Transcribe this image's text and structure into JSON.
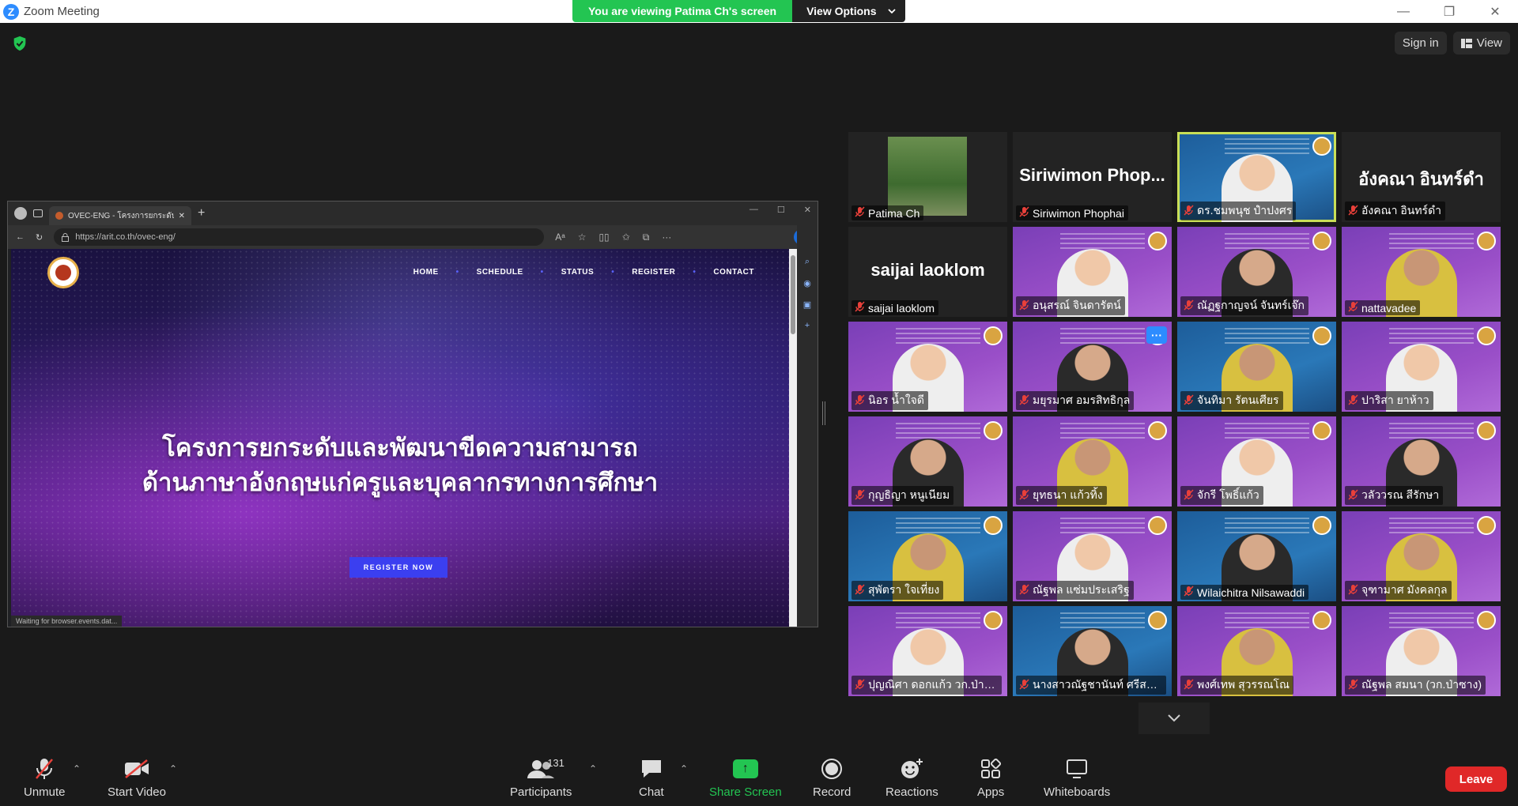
{
  "window": {
    "app_title": "Zoom Meeting",
    "logo_letter": "Z",
    "minimize": "—",
    "restore": "❐",
    "close": "✕"
  },
  "banner": {
    "message": "You are viewing Patima Ch's screen",
    "view_options": "View Options"
  },
  "top_right": {
    "sign_in": "Sign in",
    "view": "View"
  },
  "shared_screen": {
    "tab_title": "OVEC-ENG - โครงการยกระดับและ",
    "new_tab": "+",
    "url": "https://arit.co.th/ovec-eng/",
    "site": {
      "nav": [
        "HOME",
        "SCHEDULE",
        "STATUS",
        "REGISTER",
        "CONTACT"
      ],
      "hero_line1": "โครงการยกระดับและพัฒนาขีดความสามารถ",
      "hero_line2": "ด้านภาษาอังกฤษแก่ครูและบุคลากรทางการศึกษา",
      "register_button": "REGISTER NOW",
      "status_text": "Waiting for browser.events.dat..."
    }
  },
  "participants": [
    {
      "name": "Patima Ch",
      "type": "photo"
    },
    {
      "name": "Siriwimon Phophai",
      "type": "name",
      "big": "Siriwimon  Phop..."
    },
    {
      "name": "ดร.ชมพนุช ปำปงศร",
      "type": "slide-blue",
      "active": true
    },
    {
      "name": "อังคณา  อินทร์ดำ",
      "type": "name",
      "big": "อังคณา  อินทร์ดำ"
    },
    {
      "name": "saijai laoklom",
      "type": "name",
      "big": "saijai laoklom"
    },
    {
      "name": "อนุสรณ์ จินดารัตน์",
      "type": "slide"
    },
    {
      "name": "ณัฏฐกาญจน์  จันทร์เจ๊ก",
      "type": "slide"
    },
    {
      "name": "nattavadee",
      "type": "slide"
    },
    {
      "name": "นิอร  น้ำใจดี",
      "type": "slide"
    },
    {
      "name": "มยุรมาศ อมรสิทธิกุล",
      "type": "slide",
      "more": "···"
    },
    {
      "name": "จันทิมา รัตนเศียร",
      "type": "slide-blue"
    },
    {
      "name": "ปาริสา ยาห้าว",
      "type": "slide"
    },
    {
      "name": "กุญธิญา หนูเนียม",
      "type": "slide"
    },
    {
      "name": "ยุทธนา แก้วทิ้ง",
      "type": "slide"
    },
    {
      "name": "จักรี โพธิ์แก้ว",
      "type": "slide"
    },
    {
      "name": "วลัววรณ สีรักษา",
      "type": "slide"
    },
    {
      "name": "สุพัตรา ใจเที่ยง",
      "type": "slide-blue"
    },
    {
      "name": "ณัฐพล แซ่มประเสริฐ",
      "type": "slide"
    },
    {
      "name": "Wilaichitra Nilsawaddi",
      "type": "slide-blue"
    },
    {
      "name": "จุฑามาศ  มังคลกุล",
      "type": "slide"
    },
    {
      "name": "ปุญณิศา  ดอกแก้ว วก.ป่าซ...",
      "type": "slide"
    },
    {
      "name": "นางสาวณัฐชานันท์  ศรีสม...",
      "type": "slide-blue"
    },
    {
      "name": "พงศ์เทพ สุวรรณโณ",
      "type": "slide"
    },
    {
      "name": "ณัฐพล สมนา (วก.ป่าซาง)",
      "type": "slide"
    }
  ],
  "toolbar": {
    "unmute": "Unmute",
    "start_video": "Start Video",
    "participants": "Participants",
    "participant_count": "131",
    "chat": "Chat",
    "share_screen": "Share Screen",
    "record": "Record",
    "reactions": "Reactions",
    "apps": "Apps",
    "whiteboards": "Whiteboards",
    "leave": "Leave"
  }
}
